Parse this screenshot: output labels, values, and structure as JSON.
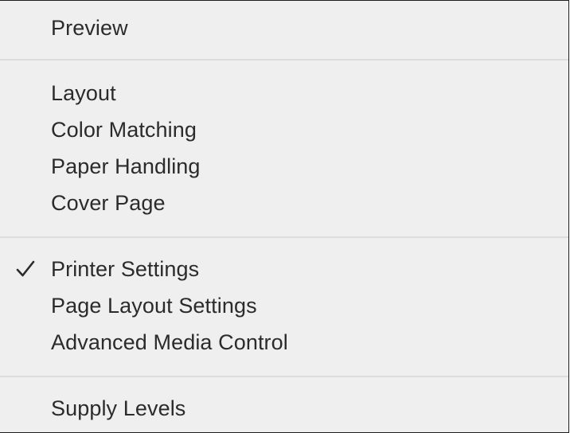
{
  "menu": {
    "items": [
      {
        "label": "Preview",
        "checked": false
      },
      {
        "label": "Layout",
        "checked": false
      },
      {
        "label": "Color Matching",
        "checked": false
      },
      {
        "label": "Paper Handling",
        "checked": false
      },
      {
        "label": "Cover Page",
        "checked": false
      },
      {
        "label": "Printer Settings",
        "checked": true
      },
      {
        "label": "Page Layout Settings",
        "checked": false
      },
      {
        "label": "Advanced Media Control",
        "checked": false
      },
      {
        "label": "Supply Levels",
        "checked": false
      }
    ],
    "checkmark_icon": "checkmark-icon"
  }
}
